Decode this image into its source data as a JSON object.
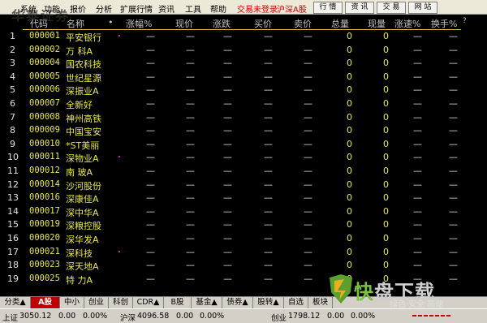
{
  "menubar": {
    "items": [
      "系统",
      "功能",
      "报价",
      "分析",
      "扩展行情",
      "资讯",
      "工具",
      "帮助"
    ],
    "status": "交易未登录",
    "market": "沪深A股",
    "buttons": [
      "行 情",
      "资 讯",
      "交 易",
      "网 站"
    ],
    "watermark": "华泰证券"
  },
  "headers": [
    "代码",
    "名称",
    "•",
    "涨幅%",
    "现价",
    "涨跌",
    "买价",
    "卖价",
    "总量",
    "现量",
    "涨速%",
    "换手%",
    "?"
  ],
  "rows": [
    {
      "idx": "1",
      "code": "000001",
      "name": "平安银行"
    },
    {
      "idx": "2",
      "code": "000002",
      "name": "万 科A"
    },
    {
      "idx": "3",
      "code": "000004",
      "name": "国农科技"
    },
    {
      "idx": "4",
      "code": "000005",
      "name": "世纪星源"
    },
    {
      "idx": "5",
      "code": "000006",
      "name": "深振业A"
    },
    {
      "idx": "6",
      "code": "000007",
      "name": "全新好"
    },
    {
      "idx": "7",
      "code": "000008",
      "name": "神州高铁"
    },
    {
      "idx": "8",
      "code": "000009",
      "name": "中国宝安"
    },
    {
      "idx": "9",
      "code": "000010",
      "name": "*ST美丽"
    },
    {
      "idx": "10",
      "code": "000011",
      "name": "深物业A"
    },
    {
      "idx": "11",
      "code": "000012",
      "name": "南 玻A"
    },
    {
      "idx": "12",
      "code": "000014",
      "name": "沙河股份"
    },
    {
      "idx": "13",
      "code": "000016",
      "name": "深康佳A"
    },
    {
      "idx": "14",
      "code": "000017",
      "name": "深中华A"
    },
    {
      "idx": "15",
      "code": "000019",
      "name": "深粮控股"
    },
    {
      "idx": "16",
      "code": "000020",
      "name": "深华发A"
    },
    {
      "idx": "17",
      "code": "000021",
      "name": "深科技"
    },
    {
      "idx": "18",
      "code": "000023",
      "name": "深天地A"
    },
    {
      "idx": "19",
      "code": "000025",
      "name": "特 力A"
    }
  ],
  "placeholders": {
    "dash": "—",
    "zero": "0"
  },
  "tabs": [
    "分类▲",
    "A股",
    "中小",
    "创业",
    "科创",
    "CDR▲",
    "B股",
    "基金▲",
    "债券▲",
    "股转▲",
    "自选",
    "板块"
  ],
  "status": {
    "sh_label": "上证",
    "sh_value": "3050.12",
    "sh_change": "0.00",
    "sh_pct": "0.00%",
    "sz_label": "沪深",
    "sz_value": "4096.58",
    "sz_change": "0.00",
    "sz_pct": "0.00%",
    "cy_label": "创业",
    "cy_value": "1798.12",
    "cy_change": "0.00",
    "cy_pct": "0.00%"
  },
  "logo": {
    "brand_a": "快",
    "brand_b": "盘下载",
    "slogan": "绿色·安全·高速"
  }
}
